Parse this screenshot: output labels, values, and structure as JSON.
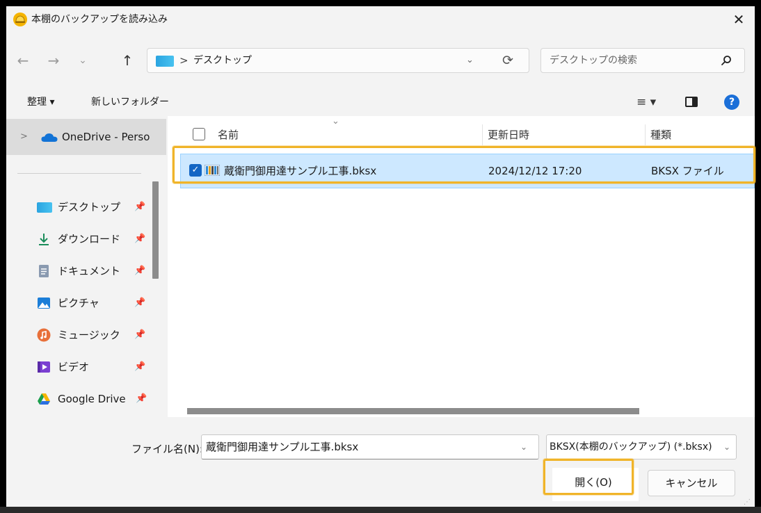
{
  "window": {
    "title": "本棚のバックアップを読み込み",
    "close_glyph": "✕"
  },
  "navigation": {
    "back_glyph": "←",
    "forward_glyph": "→",
    "recent_glyph": "⌄",
    "up_glyph": "↑"
  },
  "address": {
    "separator": ">",
    "path": "デスクトップ",
    "dropdown_glyph": "⌄",
    "refresh_glyph": "⟳"
  },
  "search": {
    "placeholder": "デスクトップの検索"
  },
  "toolbar": {
    "organize_label": "整理 ▾",
    "new_folder_label": "新しいフォルダー",
    "view_glyph": "≡ ▾",
    "help_glyph": "?"
  },
  "sidebar": {
    "onedrive_chevron": ">",
    "onedrive_label": "OneDrive - Perso",
    "pin_glyph": "📌",
    "items": [
      {
        "label": "デスクトップ",
        "icon": "desktop-icon"
      },
      {
        "label": "ダウンロード",
        "icon": "download-icon"
      },
      {
        "label": "ドキュメント",
        "icon": "document-icon"
      },
      {
        "label": "ピクチャ",
        "icon": "pictures-icon"
      },
      {
        "label": "ミュージック",
        "icon": "music-icon"
      },
      {
        "label": "ビデオ",
        "icon": "video-icon"
      },
      {
        "label": "Google Drive",
        "icon": "google-drive-icon"
      }
    ]
  },
  "file_list": {
    "sort_glyph": "⌄",
    "columns": {
      "name": "名前",
      "date": "更新日時",
      "type": "種類"
    },
    "rows": [
      {
        "selected": true,
        "check_glyph": "✓",
        "name": "蔵衛門御用達サンプル工事.bksx",
        "date": "2024/12/12 17:20",
        "type": "BKSX ファイル"
      }
    ]
  },
  "footer": {
    "filename_label": "ファイル名(N):",
    "filename_value": "蔵衛門御用達サンプル工事.bksx",
    "filename_dropdown_glyph": "⌄",
    "filetype_value": "BKSX(本棚のバックアップ) (*.bksx)",
    "filetype_dropdown_glyph": "⌄",
    "open_label": "開く(O)",
    "cancel_label": "キャンセル"
  },
  "colors": {
    "highlight": "#f0b429",
    "selection": "#cde8ff",
    "accent": "#1466c4"
  }
}
